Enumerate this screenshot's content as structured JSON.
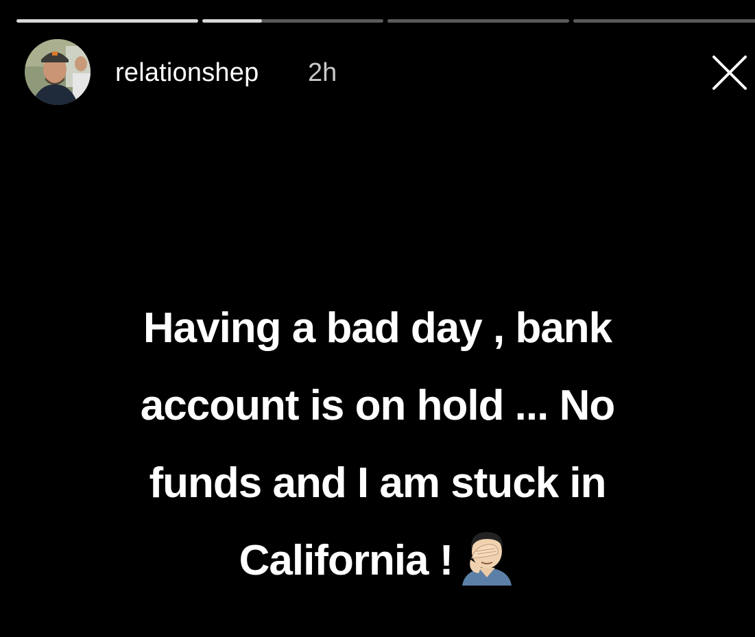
{
  "story": {
    "progress": [
      {
        "fill": 1.0
      },
      {
        "fill": 0.33
      },
      {
        "fill": 0.0
      },
      {
        "fill": 0.0
      }
    ],
    "header": {
      "username": "relationshep",
      "timestamp": "2h"
    },
    "message_lines": [
      "Having a bad day , bank",
      "account is on hold ... No",
      "funds and I am stuck in",
      "California !"
    ],
    "emoji_icon": "man-facepalming-icon",
    "close_icon": "close-icon"
  },
  "colors": {
    "background": "#000000",
    "text": "#ffffff",
    "timestamp": "#c9c9c9",
    "progress_track": "#5a5a5a",
    "progress_fill": "#d8d8d8"
  }
}
